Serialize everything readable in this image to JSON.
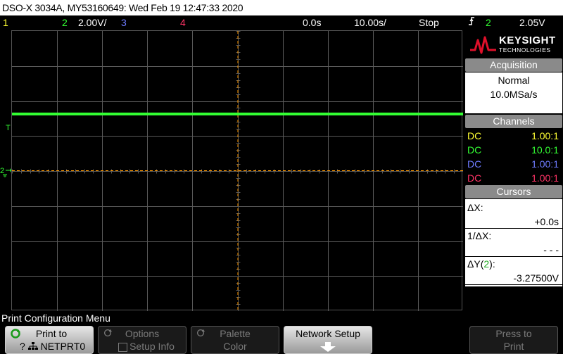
{
  "title_bar": "DSO-X 3034A, MY53160649: Wed Feb 19 12:47:33 2020",
  "status": {
    "ch1_num": "1",
    "ch2_num": "2",
    "ch2_scale": "2.00V/",
    "ch3_num": "3",
    "ch4_num": "4",
    "time_offset": "0.0s",
    "time_scale": "10.00s/",
    "run_state": "Stop",
    "trigger_icon": "ꟻ",
    "trigger_channel": "2",
    "trigger_level": "2.05V"
  },
  "colors": {
    "ch1": "#ffff33",
    "ch2": "#33ff33",
    "ch3": "#6e7bff",
    "ch4": "#ff3366",
    "trigger": "#ff9900",
    "grid": "#5a5a5a"
  },
  "markers": {
    "trigger_level": "T",
    "ch2_ground": "2"
  },
  "brand": {
    "name": "KEYSIGHT",
    "sub": "TECHNOLOGIES",
    "logo": "keysight-wave-logo"
  },
  "acquisition": {
    "heading": "Acquisition",
    "mode": "Normal",
    "rate": "10.0MSa/s"
  },
  "channels": {
    "heading": "Channels",
    "rows": [
      {
        "coupling": "DC",
        "ratio": "1.00:1"
      },
      {
        "coupling": "DC",
        "ratio": "10.0:1"
      },
      {
        "coupling": "DC",
        "ratio": "1.00:1"
      },
      {
        "coupling": "DC",
        "ratio": "1.00:1"
      }
    ]
  },
  "cursors": {
    "heading": "Cursors",
    "dx_label": "ΔX:",
    "dx_value": "+0.0s",
    "inv_dx_label": "1/ΔX:",
    "inv_dx_value": "- - -",
    "dy_label_pre": "ΔY(",
    "dy_label_ch": "2",
    "dy_label_post": "):",
    "dy_value": "-3.27500V"
  },
  "menu": {
    "title": "Print Configuration Menu",
    "print_to_label": "Print to",
    "print_to_value": "NETPRT0",
    "print_to_prefix": "?",
    "options_label": "Options",
    "setup_info_label": "Setup Info",
    "palette_label": "Palette",
    "palette_value": "Color",
    "network_setup_label": "Network Setup",
    "press_to_label": "Press to",
    "print_label": "Print"
  }
}
